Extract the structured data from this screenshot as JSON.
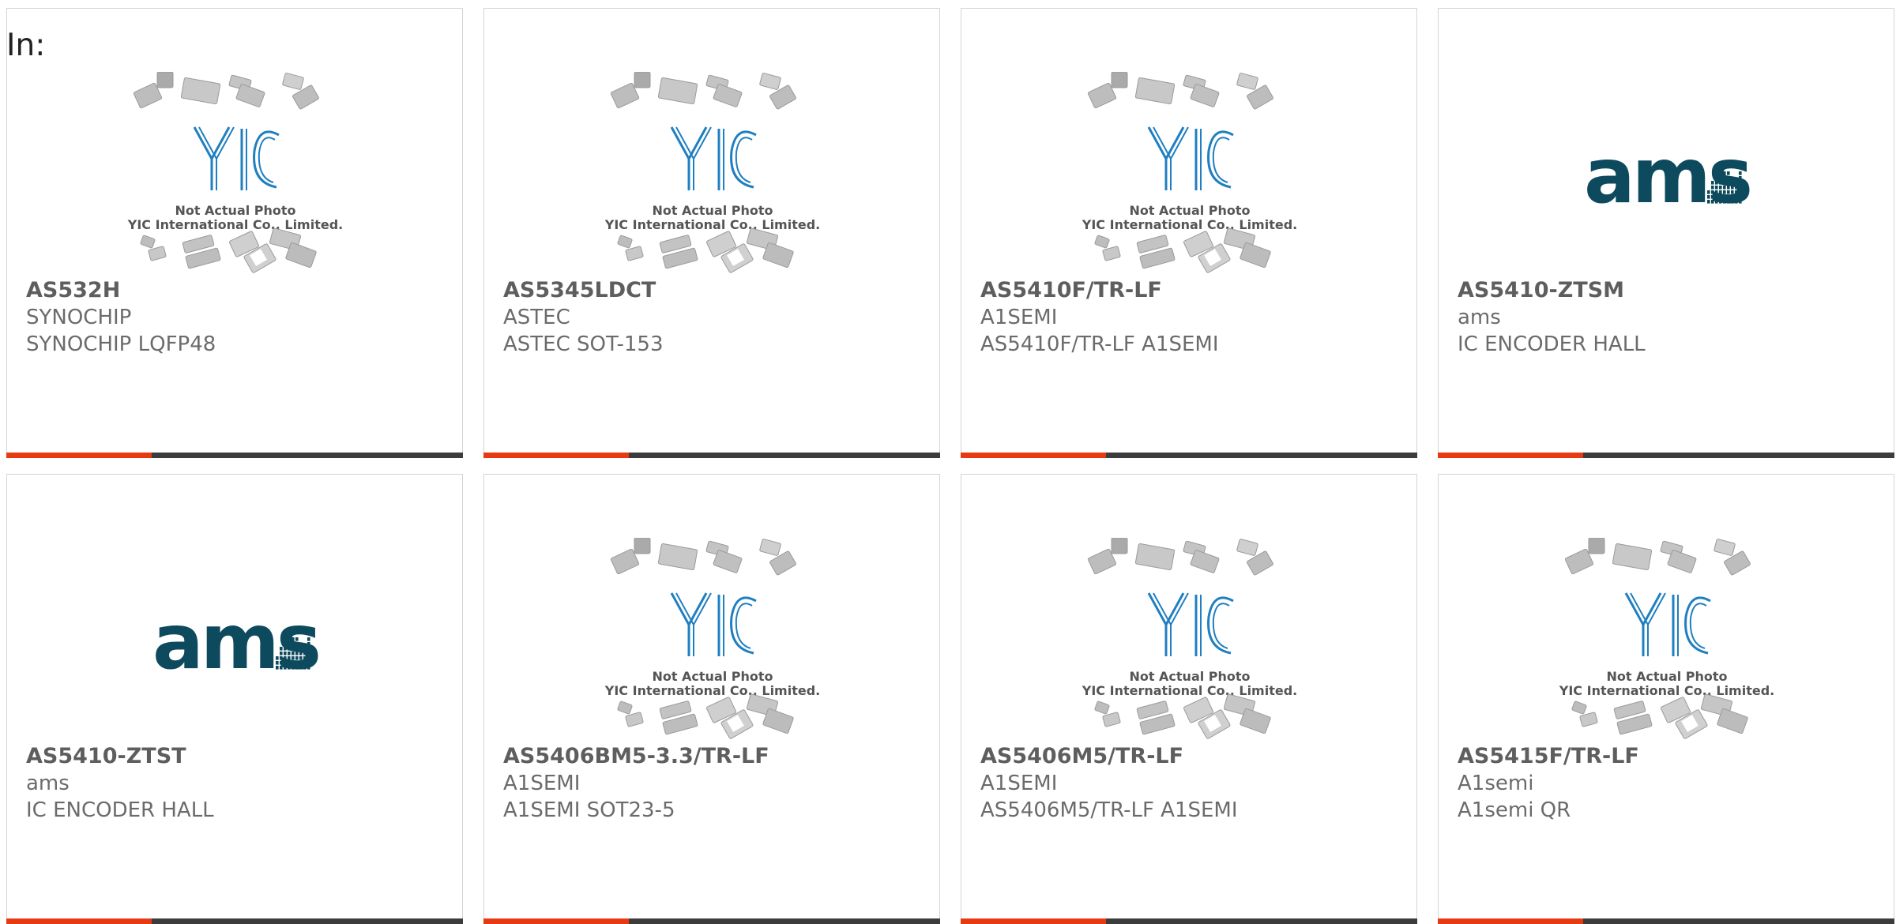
{
  "header": {
    "label": "In:"
  },
  "products": [
    {
      "part": "AS532H",
      "manufacturer": "SYNOCHIP",
      "description": "SYNOCHIP LQFP48",
      "image": "placeholder-photo"
    },
    {
      "part": "AS5345LDCT",
      "manufacturer": "ASTEC",
      "description": "ASTEC SOT-153",
      "image": "placeholder-photo"
    },
    {
      "part": "AS5410F/TR-LF",
      "manufacturer": "A1SEMI",
      "description": "AS5410F/TR-LF A1SEMI",
      "image": "placeholder-photo"
    },
    {
      "part": "AS5410-ZTSM",
      "manufacturer": "ams",
      "description": "IC ENCODER HALL",
      "image": "ams-logo"
    },
    {
      "part": "AS5410-ZTST",
      "manufacturer": "ams",
      "description": "IC ENCODER HALL",
      "image": "ams-logo"
    },
    {
      "part": "AS5406BM5-3.3/TR-LF",
      "manufacturer": "A1SEMI",
      "description": "A1SEMI SOT23-5",
      "image": "placeholder-photo"
    },
    {
      "part": "AS5406M5/TR-LF",
      "manufacturer": "A1SEMI",
      "description": "AS5406M5/TR-LF A1SEMI",
      "image": "placeholder-photo"
    },
    {
      "part": "AS5415F/TR-LF",
      "manufacturer": "A1semi",
      "description": "A1semi QR",
      "image": "placeholder-photo"
    }
  ],
  "placeholder": {
    "logo_text": "YIC",
    "line1": "Not Actual Photo",
    "line2": "YIC International Co., Limited."
  },
  "brand_logo": {
    "text": "ams"
  },
  "colors": {
    "accent": "#e63b12",
    "bar": "#3c3c3c",
    "yic_blue": "#1f7fc0",
    "ams_teal": "#0e4a5e"
  }
}
